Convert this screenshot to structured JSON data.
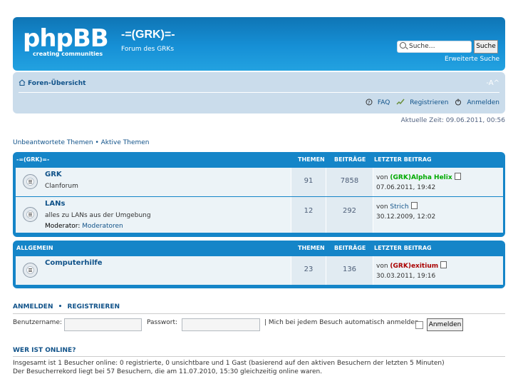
{
  "header": {
    "logo_text": "phpBB",
    "logo_tagline": "creating communities",
    "site_title": "-=(GRK)=-",
    "site_description": "Forum des GRKs",
    "search_placeholder": "Suche…",
    "search_button": "Suche",
    "advanced_search": "Erweiterte Suche"
  },
  "navbar": {
    "home": "Foren-Übersicht",
    "font_resize": "-A^",
    "faq": "FAQ",
    "register": "Registrieren",
    "login": "Anmelden"
  },
  "current_time": "Aktuelle Zeit: 09.06.2011, 00:56",
  "quick_links": "Unbeantwortete Themen • Aktive Themen",
  "categories": [
    {
      "name": "-=(GRK)=-",
      "headers": {
        "topics": "THEMEN",
        "posts": "BEITRÄGE",
        "last_post": "LETZTER BEITRAG"
      },
      "forums": [
        {
          "title": "GRK",
          "description": "Clanforum",
          "topics": "91",
          "posts": "7858",
          "by": "von",
          "last_user": "(GRK)Alpha Helix",
          "last_date": "07.06.2011, 19:42"
        },
        {
          "title": "LANs",
          "description": "alles zu LANs aus der Umgebung",
          "moderator_label": "Moderator:",
          "moderator": "Moderatoren",
          "topics": "12",
          "posts": "292",
          "by": "von",
          "last_user": "Strich",
          "last_date": "30.12.2009, 12:02"
        }
      ]
    },
    {
      "name": "ALLGEMEIN",
      "headers": {
        "topics": "THEMEN",
        "posts": "BEITRÄGE",
        "last_post": "LETZTER BEITRAG"
      },
      "forums": [
        {
          "title": "Computerhilfe",
          "description": "",
          "topics": "23",
          "posts": "136",
          "by": "von",
          "last_user": "(GRK)exitium",
          "last_date": "30.03.2011, 19:16"
        }
      ]
    }
  ],
  "login": {
    "title_login": "ANMELDEN",
    "separator": "•",
    "title_register": "REGISTRIEREN",
    "username_label": "Benutzername:",
    "password_label": "Passwort:",
    "remember": "| Mich bei jedem Besuch automatisch anmelden",
    "button": "Anmelden"
  },
  "online": {
    "title": "WER IST ONLINE?",
    "line1": "Insgesamt ist 1 Besucher online: 0 registrierte, 0 unsichtbare und 1 Gast (basierend auf den aktiven Besuchern der letzten 5 Minuten)",
    "line2": "Der Besucherrekord liegt bei 57 Besuchern, die am 11.07.2010, 15:30 gleichzeitig online waren."
  },
  "colors": {
    "header_blue": "#1585c8",
    "navbar": "#cadceb",
    "link": "#105289",
    "user_green": "#00aa00",
    "user_red": "#aa0000"
  }
}
